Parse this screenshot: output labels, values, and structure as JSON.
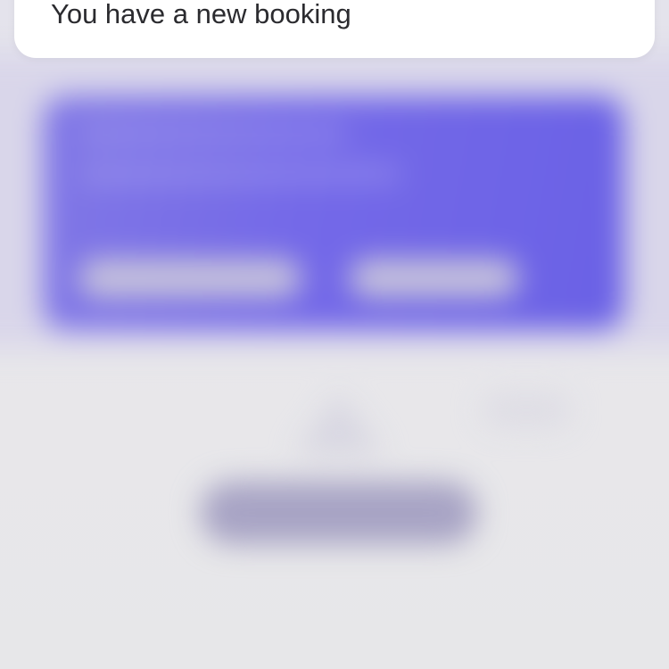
{
  "notification": {
    "message": "You have a new booking"
  },
  "colors": {
    "card_accent": "#6b62e6",
    "background": "#e7e6ea",
    "banner_background": "#ffffff",
    "text": "#2b2b2f"
  }
}
